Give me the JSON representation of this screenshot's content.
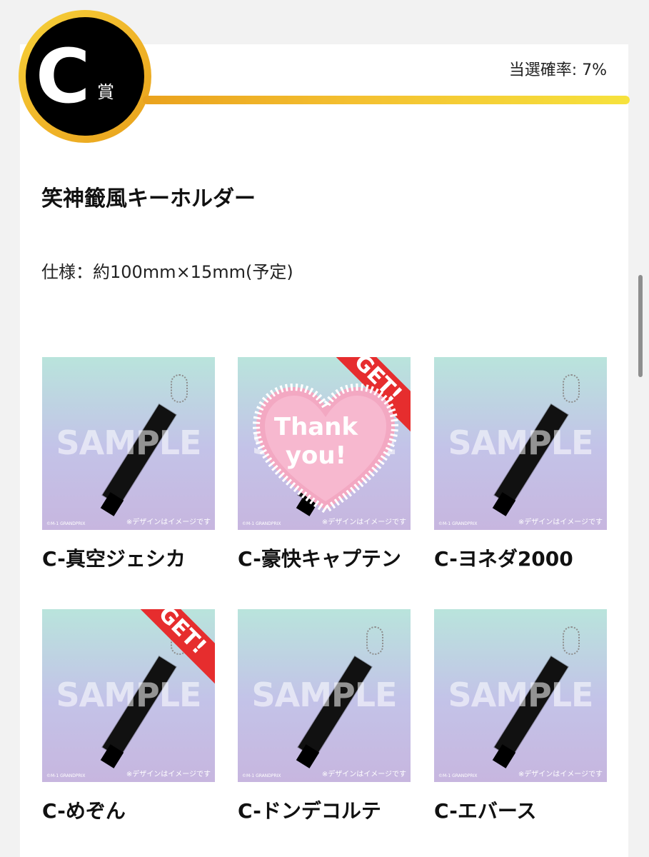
{
  "prize": {
    "letter": "C",
    "suffix": "賞",
    "probability": "当選確率: 7%",
    "title": "笑神籤風キーホルダー",
    "spec": "仕様：約100mm×15mm(予定)"
  },
  "thumbnail": {
    "watermark": "SAMPLE",
    "note": "※デザインはイメージです",
    "copyright": "©M-1 GRANDPRIX"
  },
  "items": [
    {
      "name": "C-真空ジェシカ",
      "get": false,
      "thank_you": false
    },
    {
      "name": "C-豪快キャプテン",
      "get": true,
      "thank_you": true,
      "get_label": "GET!",
      "thank_you_text": "Thank you!"
    },
    {
      "name": "C-ヨネダ2000",
      "get": false,
      "thank_you": false
    },
    {
      "name": "C-めぞん",
      "get": true,
      "thank_you": false,
      "get_label": "GET!"
    },
    {
      "name": "C-ドンデコルテ",
      "get": false,
      "thank_you": false
    },
    {
      "name": "C-エバース",
      "get": false,
      "thank_you": false
    }
  ],
  "colors": {
    "badge_gold": "#f0b428",
    "get_red": "#e62d2e",
    "heart_pink": "#f3a8c2"
  }
}
